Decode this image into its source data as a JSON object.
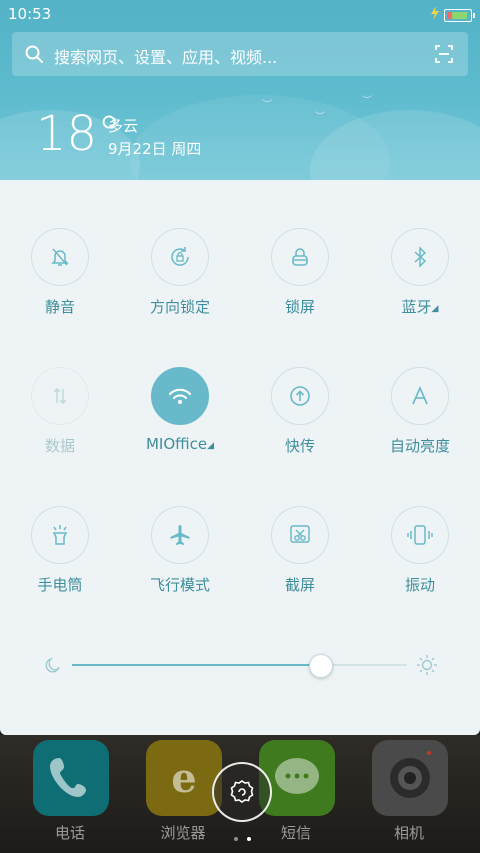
{
  "status_bar": {
    "time": "10:53",
    "battery_icon": "battery-icon",
    "charging_icon": "charging-icon"
  },
  "search": {
    "placeholder": "搜索网页、设置、应用、视频...",
    "search_icon": "search-icon",
    "scan_icon": "scan-icon"
  },
  "weather": {
    "temperature": "18°",
    "condition": "多云",
    "date": "9月22日 周四"
  },
  "toggles": [
    {
      "label": "静音",
      "icon": "mute-bell-icon",
      "state": "off"
    },
    {
      "label": "方向锁定",
      "icon": "rotation-lock-icon",
      "state": "off"
    },
    {
      "label": "锁屏",
      "icon": "lock-icon",
      "state": "off"
    },
    {
      "label": "蓝牙",
      "icon": "bluetooth-icon",
      "state": "off",
      "has_menu": true
    },
    {
      "label": "数据",
      "icon": "data-icon",
      "state": "disabled"
    },
    {
      "label": "MIOffice",
      "icon": "wifi-icon",
      "state": "on",
      "has_menu": true
    },
    {
      "label": "快传",
      "icon": "quick-transfer-icon",
      "state": "off"
    },
    {
      "label": "自动亮度",
      "icon": "auto-brightness-icon",
      "state": "off"
    },
    {
      "label": "手电筒",
      "icon": "flashlight-icon",
      "state": "off"
    },
    {
      "label": "飞行模式",
      "icon": "airplane-icon",
      "state": "off"
    },
    {
      "label": "截屏",
      "icon": "screenshot-icon",
      "state": "off"
    },
    {
      "label": "振动",
      "icon": "vibrate-icon",
      "state": "off"
    }
  ],
  "brightness": {
    "level_fraction": 0.74,
    "low_icon": "moon-icon",
    "high_icon": "sun-icon"
  },
  "dock": [
    {
      "label": "电话",
      "icon": "phone-icon",
      "color": "#0e6e74"
    },
    {
      "label": "浏览器",
      "icon": "browser-icon",
      "color": "#7b6a12"
    },
    {
      "label": "短信",
      "icon": "messages-icon",
      "color": "#3f7a1f"
    },
    {
      "label": "相机",
      "icon": "camera-icon",
      "color": "#4a4a4a"
    }
  ],
  "colors": {
    "accent": "#68b9c9",
    "label": "#3f8e9d",
    "header_top": "#53b2c6",
    "panel_bg": "#eef4f5"
  },
  "page_dots": {
    "count": 2,
    "active": 1
  }
}
